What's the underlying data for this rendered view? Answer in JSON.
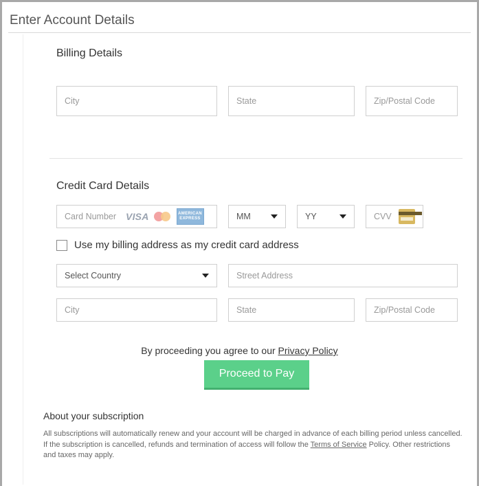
{
  "page_title": "Enter Account Details",
  "billing": {
    "heading": "Billing Details",
    "city_placeholder": "City",
    "state_placeholder": "State",
    "zip_placeholder": "Zip/Postal Code"
  },
  "credit_card": {
    "heading": "Credit Card Details",
    "card_number_placeholder": "Card Number",
    "card_logos": [
      "visa-icon",
      "mastercard-icon",
      "american-express-icon"
    ],
    "visa_text": "VISA",
    "amex_text_line1": "AMERICAN",
    "amex_text_line2": "EXPRESS",
    "month_select": "MM",
    "year_select": "YY",
    "cvv_placeholder": "CVV",
    "use_billing_label": "Use my billing address as my credit card address",
    "country_select": "Select Country",
    "street_placeholder": "Street Address",
    "city_placeholder": "City",
    "state_placeholder": "State",
    "zip_placeholder": "Zip/Postal Code"
  },
  "agreement": {
    "prefix": "By proceeding you agree to our ",
    "link": "Privacy Policy"
  },
  "pay_button": "Proceed to Pay",
  "about": {
    "title": "About your subscription",
    "text_before_link": "All subscriptions will automatically renew and your account will be charged in advance of each billing period unless cancelled. If the subscription is cancelled, refunds and termination of access will follow the ",
    "link": "Terms of Service",
    "text_after_link": " Policy. Other restrictions and taxes may apply."
  },
  "colors": {
    "pay_button": "#5bd08a",
    "border": "#cfcfcf"
  }
}
